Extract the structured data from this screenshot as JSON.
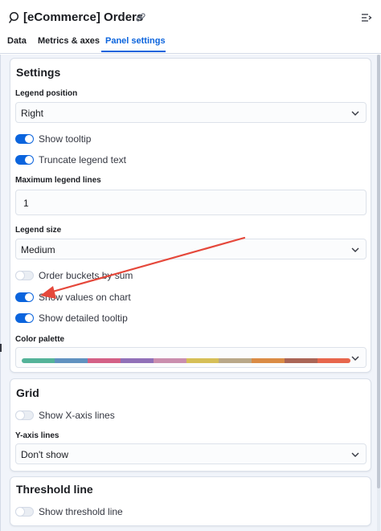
{
  "header": {
    "title": "[eCommerce] Orders"
  },
  "tabs": [
    {
      "label": "Data"
    },
    {
      "label": "Metrics & axes"
    },
    {
      "label": "Panel settings"
    }
  ],
  "settings": {
    "title": "Settings",
    "legend_position": {
      "label": "Legend position",
      "value": "Right"
    },
    "show_tooltip": {
      "label": "Show tooltip",
      "on": true
    },
    "truncate_legend": {
      "label": "Truncate legend text",
      "on": true
    },
    "max_legend_lines": {
      "label": "Maximum legend lines",
      "value": "1"
    },
    "legend_size": {
      "label": "Legend size",
      "value": "Medium"
    },
    "order_buckets": {
      "label": "Order buckets by sum",
      "on": false
    },
    "show_values": {
      "label": "Show values on chart",
      "on": true
    },
    "show_detailed_tooltip": {
      "label": "Show detailed tooltip",
      "on": true
    },
    "color_palette": {
      "label": "Color palette",
      "colors": [
        "#54b399",
        "#6092c0",
        "#d36086",
        "#9170b8",
        "#ca8eae",
        "#d6bf57",
        "#b9a888",
        "#da8b45",
        "#aa6556",
        "#e7664c"
      ]
    }
  },
  "grid": {
    "title": "Grid",
    "show_x_axis_lines": {
      "label": "Show X-axis lines",
      "on": false
    },
    "y_axis_lines": {
      "label": "Y-axis lines",
      "value": "Don't show"
    }
  },
  "threshold": {
    "title": "Threshold line",
    "show_threshold": {
      "label": "Show threshold line",
      "on": false
    }
  },
  "colors": {
    "accent": "#0b64dd",
    "annotation_arrow": "#e5483b"
  }
}
